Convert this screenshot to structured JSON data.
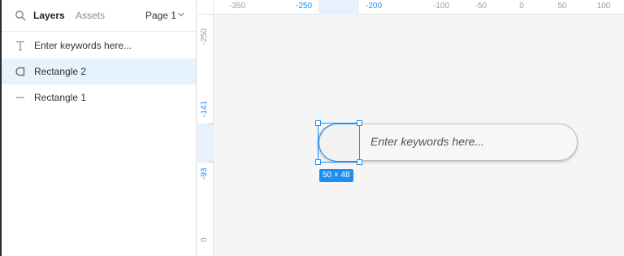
{
  "panel": {
    "tabs": {
      "layers": "Layers",
      "assets": "Assets"
    },
    "page_selector": "Page 1",
    "layers": [
      {
        "label": "Enter keywords here...",
        "icon": "text-icon",
        "selected": false
      },
      {
        "label": "Rectangle 2",
        "icon": "half-rounded-rectangle-icon",
        "selected": true
      },
      {
        "label": "Rectangle 1",
        "icon": "line-icon",
        "selected": false
      }
    ]
  },
  "ruler": {
    "top_labels": [
      "-350",
      "-250",
      "-200",
      "-100",
      "-50",
      "0",
      "50",
      "100"
    ],
    "top_selected": [
      "-250",
      "-200"
    ],
    "left_labels": [
      "-250",
      "-141",
      "-93",
      "0"
    ],
    "left_selected": [
      "-141",
      "-93"
    ]
  },
  "canvas": {
    "search_placeholder": "Enter keywords here...",
    "selection_size": "50 × 48"
  },
  "colors": {
    "accent": "#1e8ff0",
    "selected_row": "#e6f2fc",
    "canvas_bg": "#f5f5f5"
  }
}
